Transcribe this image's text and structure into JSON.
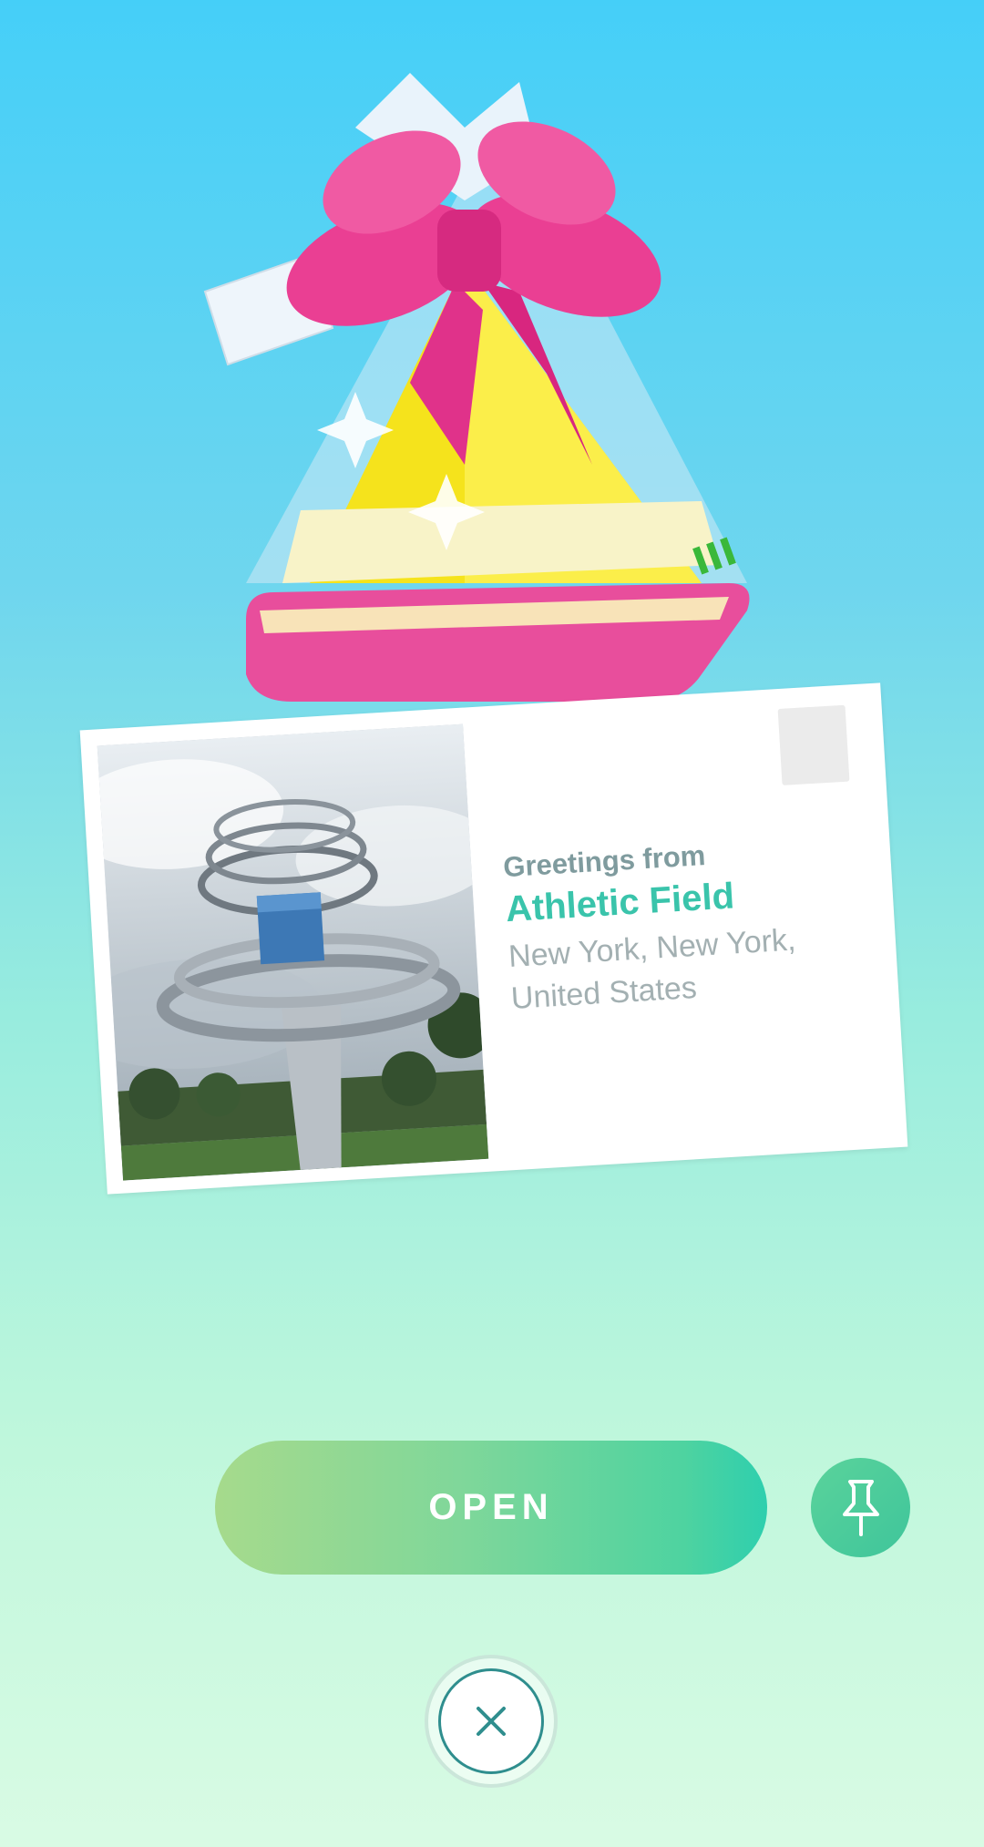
{
  "gift": {
    "icon": "gift-box-icon",
    "colors": {
      "bow": "#e8378f",
      "box": "#f7e21f",
      "base": "#e84e9c"
    }
  },
  "postcard": {
    "greeting": "Greetings from",
    "place_name": "Athletic Field",
    "location_line1": "New York, New York,",
    "location_line2": "United States",
    "accent_color": "#3ac4ab"
  },
  "actions": {
    "open_label": "OPEN",
    "pin_icon": "pin-icon",
    "close_icon": "close-icon"
  }
}
